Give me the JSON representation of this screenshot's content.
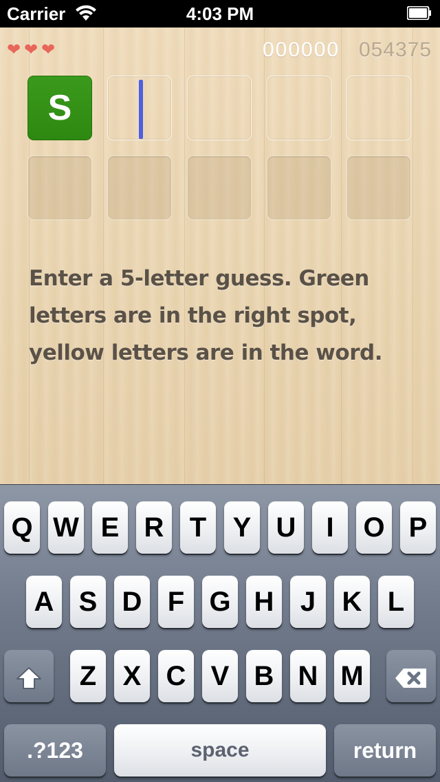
{
  "status_bar": {
    "carrier": "Carrier",
    "time": "4:03 PM"
  },
  "game": {
    "lives": 3,
    "score_placeholder": "000000",
    "score": "054375",
    "row1": [
      {
        "letter": "S",
        "state": "correct"
      },
      {
        "letter": "",
        "state": "active"
      },
      {
        "letter": "",
        "state": "empty"
      },
      {
        "letter": "",
        "state": "empty"
      },
      {
        "letter": "",
        "state": "empty"
      }
    ],
    "row2": [
      {
        "letter": "",
        "state": "slot"
      },
      {
        "letter": "",
        "state": "slot"
      },
      {
        "letter": "",
        "state": "slot"
      },
      {
        "letter": "",
        "state": "slot"
      },
      {
        "letter": "",
        "state": "slot"
      }
    ],
    "instructions": "Enter a 5-letter guess. Green letters are in the right spot, yellow letters are in the word.",
    "colors": {
      "correct": "#2e8811",
      "cursor": "#4d5fe0",
      "heart": "#e8665a"
    }
  },
  "keyboard": {
    "row1": [
      "Q",
      "W",
      "E",
      "R",
      "T",
      "Y",
      "U",
      "I",
      "O",
      "P"
    ],
    "row2": [
      "A",
      "S",
      "D",
      "F",
      "G",
      "H",
      "J",
      "K",
      "L"
    ],
    "row3": [
      "Z",
      "X",
      "C",
      "V",
      "B",
      "N",
      "M"
    ],
    "numbers_label": ".?123",
    "space_label": "space",
    "return_label": "return",
    "shift_icon": "shift-icon",
    "delete_icon": "delete-icon"
  }
}
